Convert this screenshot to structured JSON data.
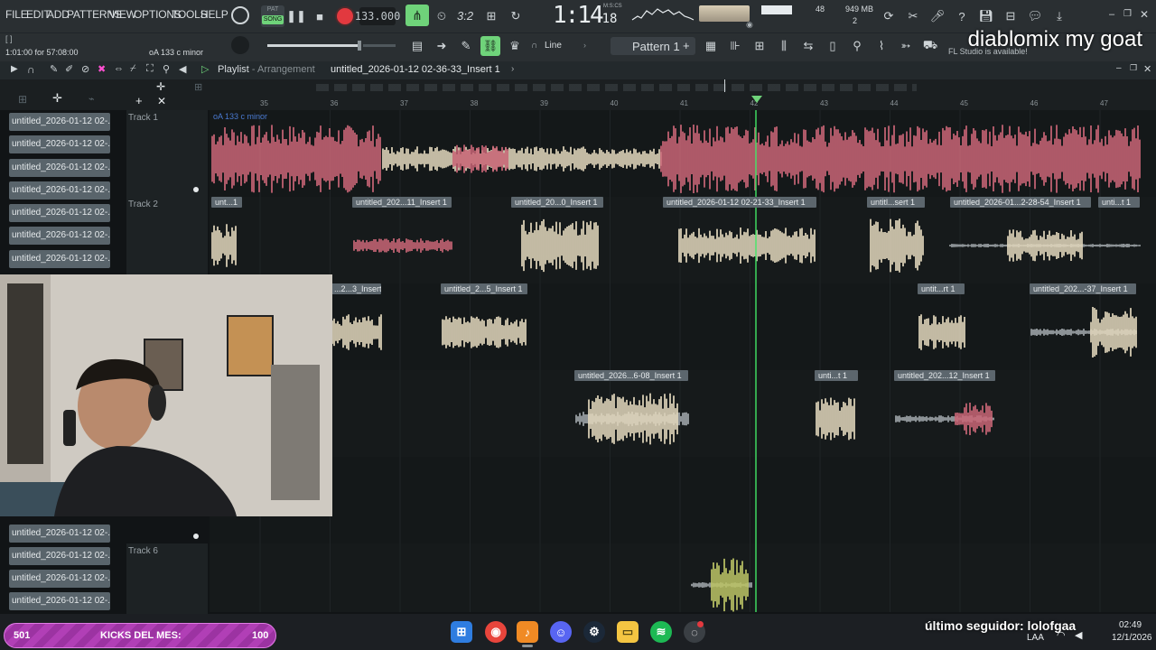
{
  "menu": [
    "FILE",
    "EDIT",
    "ADD",
    "PATTERNS",
    "VIEW",
    "OPTIONS",
    "TOOLS",
    "HELP"
  ],
  "transport": {
    "pat_label": "PAT",
    "song_label": "SONG",
    "tempo": "133.000",
    "bars_display": "3:2",
    "time_main": "1:14",
    "time_sub": "18",
    "time_unit": "M:S:CS",
    "cpu_value": "48",
    "memory": "949 MB",
    "poly": "2"
  },
  "hint_bar": {
    "position": "1:01:00 for 57:08:00",
    "key_hint": "oA 133 c minor"
  },
  "toolbar2": {
    "snap": "Line",
    "pattern": "Pattern 1",
    "update_note": "FL Studio is available!"
  },
  "overlay_text": "diablomix my goat",
  "playlist": {
    "title": "Playlist",
    "separator": "-",
    "subtitle": "Arrangement",
    "selected_clip": "untitled_2026-01-12 02-36-33_Insert 1",
    "ruler": [
      "35",
      "36",
      "37",
      "38",
      "39",
      "40",
      "41",
      "42",
      "43",
      "44",
      "45",
      "46",
      "47"
    ]
  },
  "browser_channels": [
    "untitled_2026-01-12 02-...",
    "untitled_2026-01-12 02-...",
    "untitled_2026-01-12 02-...",
    "untitled_2026-01-12 02-...",
    "untitled_2026-01-12 02-...",
    "untitled_2026-01-12 02-...",
    "untitled_2026-01-12 02-...",
    "untitled_2026-01-12 02-...",
    "untitled_2026-01-12 02-...",
    "untitled_2026-01-12 02-...",
    "untitled_2026-01-12 02-..."
  ],
  "tracks": {
    "track1": "Track 1",
    "track2": "Track 2",
    "track6": "Track 6"
  },
  "clips": {
    "t1_label": "oA 133 c minor",
    "t2": [
      "unt...1",
      "untitled_202...11_Insert 1",
      "untitled_20...0_Insert 1",
      "untitled_2026-01-12 02-21-33_Insert 1",
      "untitl...sert 1",
      "untitled_2026-01...2-28-54_Insert 1",
      "unti...t 1"
    ],
    "t3": [
      "...2...3_Insert 1",
      "untitled_2...5_Insert 1",
      "untit...rt 1",
      "untitled_202...-37_Insert 1"
    ],
    "t4": [
      "untitled_2026...6-08_Insert 1",
      "unti...t 1",
      "untitled_202...12_Insert 1"
    ]
  },
  "stream": {
    "kicks_count": "501",
    "kicks_label": "KICKS DEL MES:",
    "kicks_goal": "100",
    "follower": "último seguidor: lolofgaa"
  },
  "system_tray": {
    "lang": "LAA",
    "time": "02:49",
    "date": "12/1/2026"
  },
  "colors": {
    "accent_green": "#6fd37a",
    "record_red": "#e2393f",
    "clip_pink": "#d46a7c",
    "clip_cream": "#efe3c6",
    "clip_olive": "#c7cf6a",
    "playhead": "#3fd760"
  }
}
